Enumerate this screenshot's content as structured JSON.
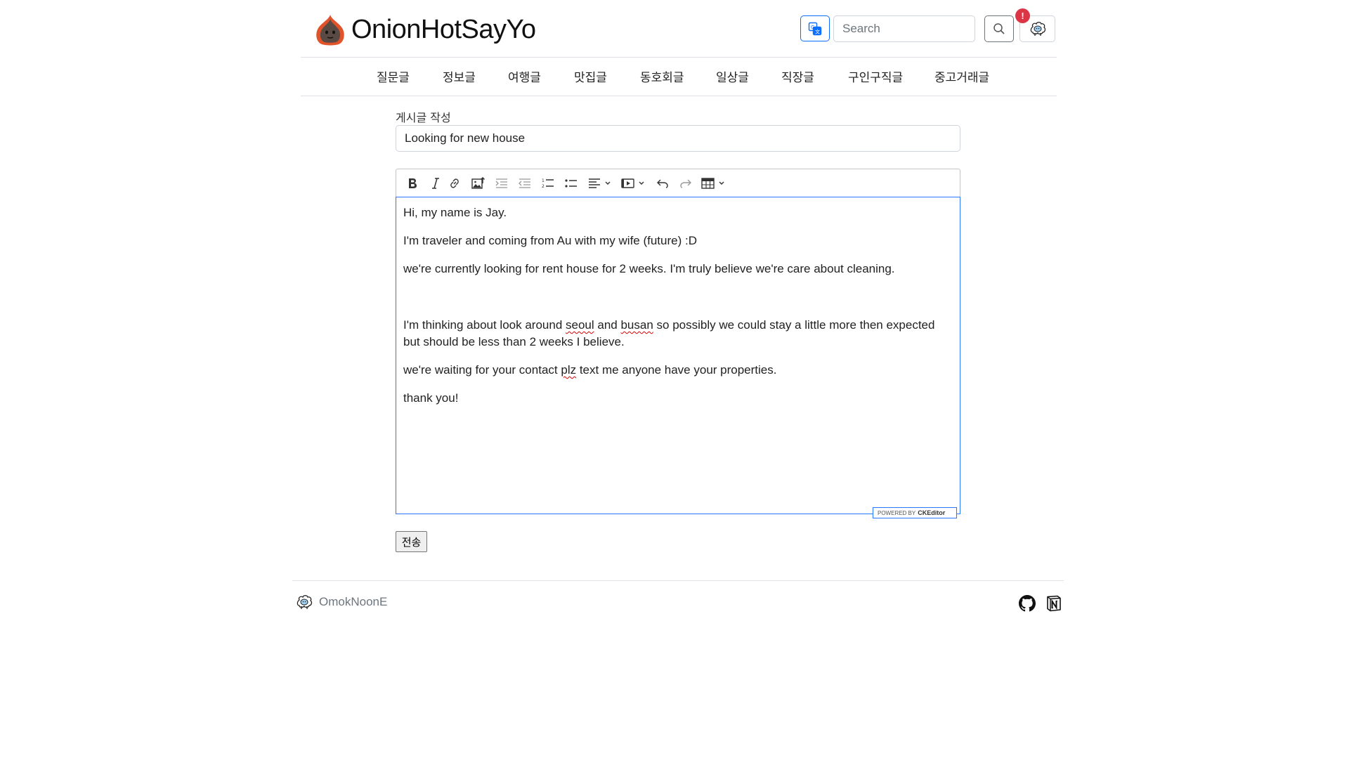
{
  "header": {
    "logo_text": "OnionHotSayYo",
    "logo_icon": "onion-logo-icon",
    "translate_icon": "translate-icon",
    "search_placeholder": "Search",
    "search_icon": "search-icon",
    "notification_count": "!",
    "profile_icon": "sheep-avatar-icon"
  },
  "nav": {
    "items": [
      "질문글",
      "정보글",
      "여행글",
      "맛집글",
      "동호회글",
      "일상글",
      "직장글",
      "구인구직글",
      "중고거래글"
    ]
  },
  "form": {
    "label": "게시글 작성",
    "title_value": "Looking for new house",
    "submit_label": "전송"
  },
  "editor": {
    "toolbar": [
      "bold-icon",
      "italic-icon",
      "link-icon",
      "image-upload-icon",
      "indent-icon",
      "outdent-icon",
      "numbered-list-icon",
      "bulleted-list-icon",
      "align-icon",
      "media-embed-icon",
      "undo-icon",
      "redo-icon",
      "table-icon"
    ],
    "p1": "Hi, my name is Jay.",
    "p2": "I'm traveler and coming from Au with my wife (future) :D",
    "p3": "we're currently looking for rent house for 2 weeks. I'm truly believe we're care about cleaning.",
    "p4a": "I'm thinking about look around ",
    "p4b": "seoul",
    "p4c": " and ",
    "p4d": "busan",
    "p4e": " so possibly we could stay a little more then expected but should be less than 2 weeks I believe.",
    "p5a": "we're waiting for your contact ",
    "p5b": "plz",
    "p5c": " text me anyone have your properties.",
    "p6": "thank you!",
    "powered_by": "POWERED BY",
    "powered_brand": "CKEditor"
  },
  "footer": {
    "name": "OmokNoonE",
    "logo_icon": "sheep-logo-icon",
    "github_icon": "github-icon",
    "notion_icon": "notion-icon"
  },
  "colors": {
    "primary": "#0d6efd",
    "danger": "#dc3545",
    "editor_focus": "#2977ff",
    "onion": "#e0532b"
  }
}
